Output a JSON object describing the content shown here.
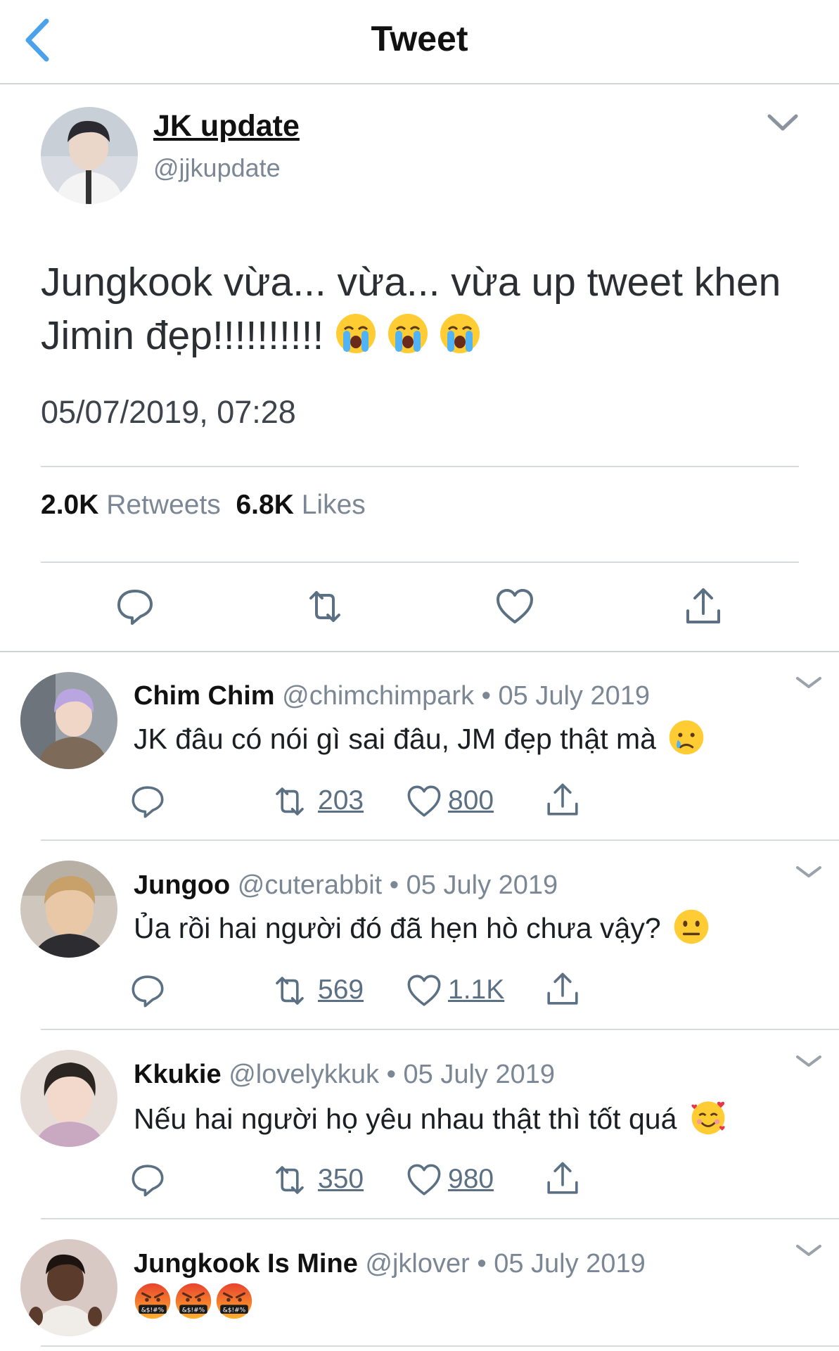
{
  "header": {
    "title": "Tweet",
    "back_icon": "back-chevron-icon",
    "accent": "#4aa1ec"
  },
  "tweet": {
    "author_name": "JK update",
    "author_handle": "@jjkupdate",
    "text": "Jungkook vừa... vừa... vừa up tweet khen Jimin đẹp!!!!!!!!!!",
    "emoji": [
      "loudly-crying-face",
      "loudly-crying-face",
      "loudly-crying-face"
    ],
    "timestamp": "05/07/2019, 07:28",
    "retweets_count": "2.0K",
    "retweets_label": "Retweets",
    "likes_count": "6.8K",
    "likes_label": "Likes"
  },
  "replies": [
    {
      "name": "Chim Chim",
      "handle": "@chimchimpark",
      "dot": "•",
      "date": "05 July 2019",
      "text": "JK đâu có nói gì sai đâu, JM đẹp thật mà",
      "emoji": [
        "crying-face"
      ],
      "retweets": "203",
      "likes": "800"
    },
    {
      "name": "Jungoo",
      "handle": "@cuterabbit",
      "dot": "•",
      "date": "05 July 2019",
      "text": "Ủa rồi hai người đó đã hẹn hò chưa vậy?",
      "emoji": [
        "neutral-face"
      ],
      "retweets": "569",
      "likes": "1.1K"
    },
    {
      "name": "Kkukie",
      "handle": "@lovelykkuk",
      "dot": "•",
      "date": "05 July 2019",
      "text": "Nếu hai người họ yêu nhau thật thì tốt quá",
      "emoji": [
        "smiling-face-with-hearts"
      ],
      "retweets": "350",
      "likes": "980"
    },
    {
      "name": "Jungkook Is Mine",
      "handle": "@jklover",
      "dot": "•",
      "date": "05 July 2019",
      "text": "",
      "emoji": [
        "face-with-symbols-on-mouth",
        "face-with-symbols-on-mouth",
        "face-with-symbols-on-mouth"
      ],
      "emoji_text": "&$!#%"
    }
  ]
}
